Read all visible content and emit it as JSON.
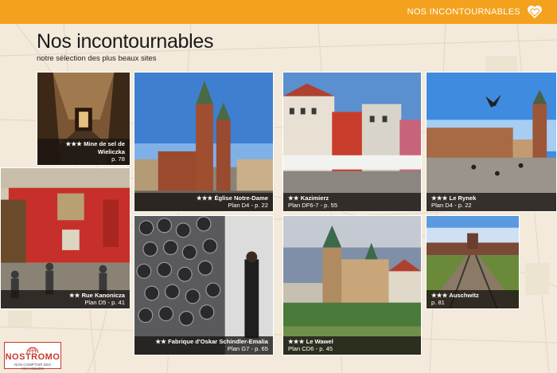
{
  "header": {
    "section_title": "NOS INCONTOURNABLES",
    "icon": "heart-icon",
    "accent": "#f4a11d"
  },
  "page": {
    "title": "Nos incontournables",
    "subtitle": "notre sélection des plus beaux sites"
  },
  "sites": [
    {
      "stars": "★★★",
      "name": "Mine de sel de Wieliczka",
      "ref": "p. 78"
    },
    {
      "stars": "★★★",
      "name": "Église Notre-Dame",
      "ref": "Plan D4 - p. 22"
    },
    {
      "stars": "★★",
      "name": "Kazimierz",
      "ref": "Plan DF6-7 - p. 55"
    },
    {
      "stars": "★★★",
      "name": "Le Rynek",
      "ref": "Plan D4 - p. 22"
    },
    {
      "stars": "★★",
      "name": "Rue Kanonicza",
      "ref": "Plan D5 - p. 41"
    },
    {
      "stars": "★★",
      "name": "Fabrique d'Oskar Schindler-Emalia",
      "ref": "Plan G7 - p. 65"
    },
    {
      "stars": "★★★",
      "name": "Le Wawel",
      "ref": "Plan CD6 - p. 45"
    },
    {
      "stars": "★★★",
      "name": "Auschwitz",
      "ref": "p. 81"
    }
  ],
  "logo": {
    "name": "NOSTROMO",
    "tagline": "NON COMPTOIR DES VOYAGEURS",
    "brand_color": "#c53a2a"
  }
}
